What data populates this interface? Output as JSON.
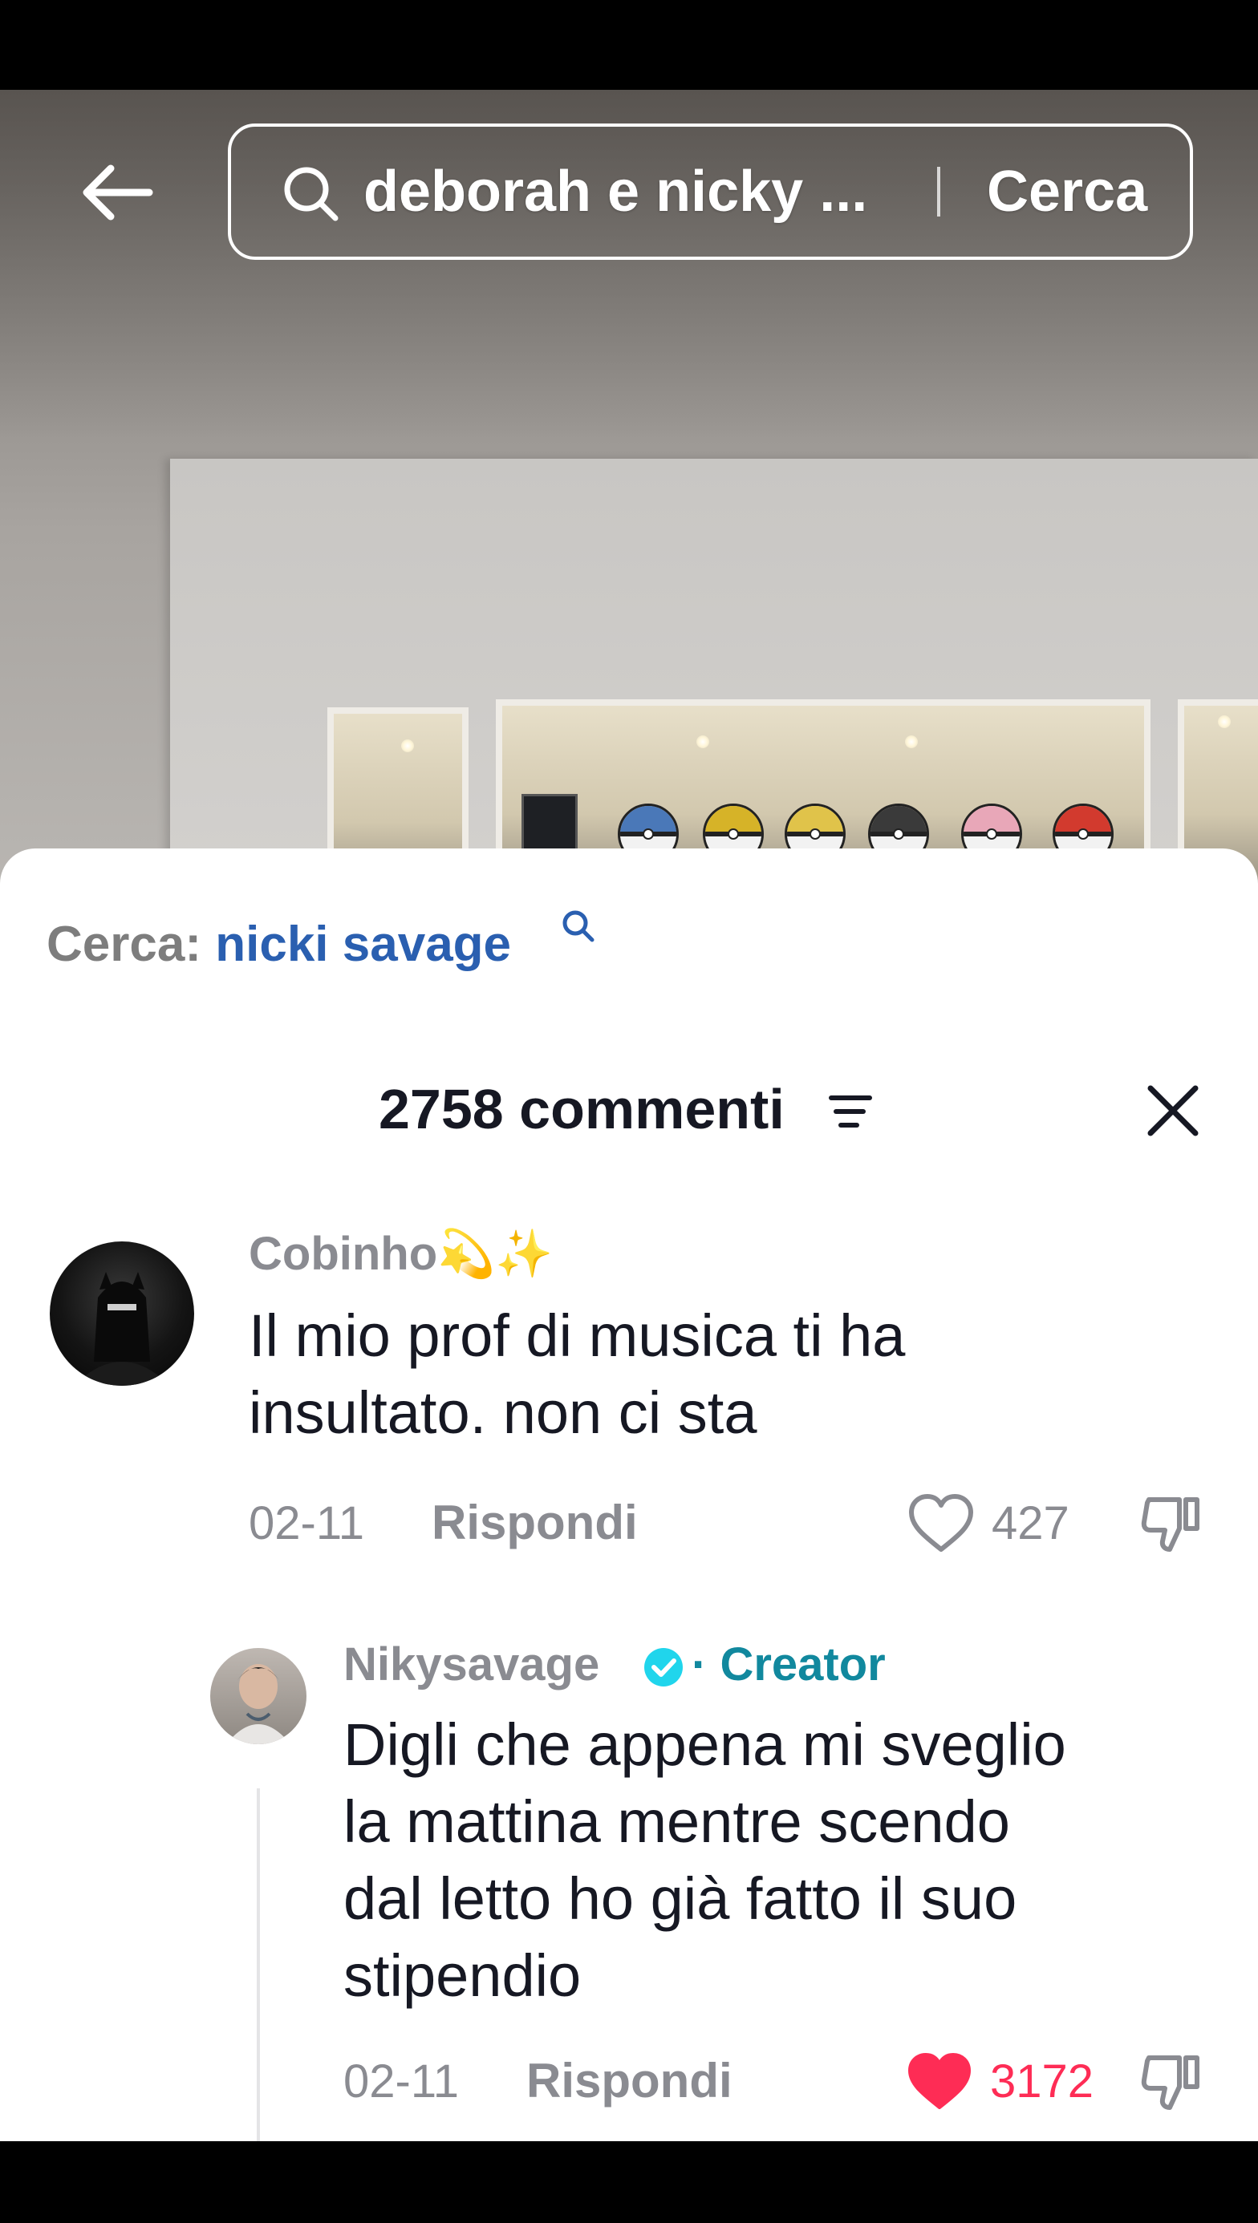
{
  "search": {
    "query": "deborah e nicky ...",
    "submit_label": "Cerca"
  },
  "comments": {
    "suggestion_label": "Cerca:",
    "suggestion_term": "nicki savage",
    "title": "2758 commenti"
  },
  "comment_list": [
    {
      "username": "Cobinho💫✨",
      "text_line1": "Il mio prof di musica ti ha",
      "text_line2": "insultato. non ci sta",
      "date": "02-11",
      "reply_label": "Rispondi",
      "likes": "427",
      "liked": false
    }
  ],
  "reply": {
    "username": "Nikysavage",
    "badge_separator": "·",
    "badge_label": "Creator",
    "text_line1": "Digli che appena mi sveglio",
    "text_line2": "la mattina mentre scendo",
    "text_line3": "dal letto ho già fatto il suo",
    "text_line4": "stipendio",
    "date": "02-11",
    "reply_label": "Rispondi",
    "likes": "3172",
    "liked": true
  },
  "colors": {
    "liked_heart": "#fe2c55",
    "creator_accent": "#11889e",
    "suggestion_link": "#2a5fb0",
    "verified": "#20d5ec"
  },
  "icons": [
    "back-arrow-icon",
    "search-icon",
    "sort-icon",
    "close-icon",
    "heart-icon",
    "dislike-icon",
    "verified-icon"
  ]
}
